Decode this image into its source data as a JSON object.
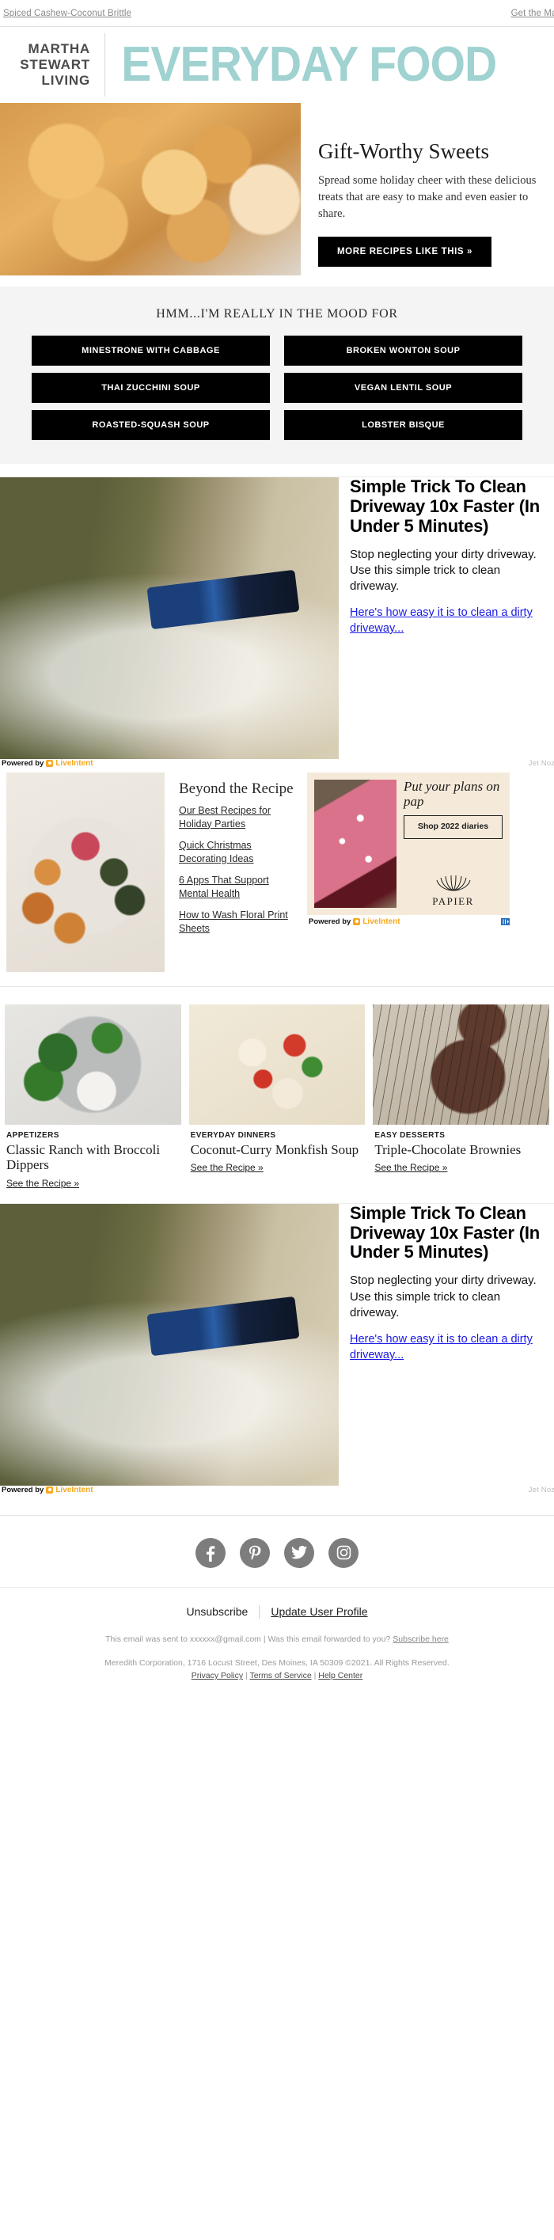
{
  "preheader": {
    "left_link": "Spiced Cashew-Coconut Brittle",
    "right_link": "Get the Magazine"
  },
  "masthead": {
    "brand_line1": "MARTHA",
    "brand_line2": "STEWART",
    "brand_line3": "LIVING",
    "title": "EVERYDAY FOOD",
    "accent_color": "#9fd2d0"
  },
  "hero": {
    "title": "Gift-Worthy Sweets",
    "body": "Spread some holiday cheer with these delicious treats that are easy to make and even easier to share.",
    "cta": "MORE RECIPES LIKE THIS »",
    "image_alt": "cashew brittle"
  },
  "mood": {
    "title": "HMM...I'M REALLY IN THE MOOD FOR",
    "buttons": [
      "MINESTRONE WITH CABBAGE",
      "BROKEN WONTON SOUP",
      "THAI ZUCCHINI SOUP",
      "VEGAN LENTIL SOUP",
      "ROASTED-SQUASH SOUP",
      "LOBSTER BISQUE"
    ]
  },
  "ad": {
    "headline": "Simple Trick To Clean Driveway 10x Faster (In Under 5 Minutes)",
    "body": "Stop neglecting your dirty driveway. Use this simple trick to clean driveway.",
    "link": "Here's how easy it is to clean a dirty driveway...",
    "powered_by": "Powered by",
    "network": "LiveIntent",
    "sponsor": "Jet Nozzle"
  },
  "beyond": {
    "title": "Beyond the Recipe",
    "links": [
      "Our Best Recipes for Holiday Parties",
      "Quick Christmas Decorating Ideas",
      "6 Apps That Support Mental Health",
      "How to Wash Floral Print Sheets"
    ]
  },
  "papier": {
    "headline": "Put your plans on pap",
    "cta": "Shop 2022 diaries",
    "brand": "PAPIER",
    "powered_by": "Powered by",
    "network": "LiveIntent"
  },
  "cards": [
    {
      "kicker": "APPETIZERS",
      "title": "Classic Ranch with Broccoli Dippers",
      "link": "See the Recipe »"
    },
    {
      "kicker": "EVERYDAY DINNERS",
      "title": "Coconut-Curry Monkfish Soup",
      "link": "See the Recipe »"
    },
    {
      "kicker": "EASY DESSERTS",
      "title": "Triple-Chocolate Brownies",
      "link": "See the Recipe »"
    }
  ],
  "social": [
    {
      "name": "facebook",
      "glyph": "f"
    },
    {
      "name": "pinterest",
      "glyph": "p"
    },
    {
      "name": "twitter",
      "glyph": "🐦"
    },
    {
      "name": "instagram",
      "glyph": "▢"
    }
  ],
  "footer": {
    "unsubscribe": "Unsubscribe",
    "update_profile": "Update User Profile",
    "sent_to_prefix": "This email was sent to xxxxxx@gmail.com",
    "separator": "|",
    "forwarded": "Was this email forwarded to you?",
    "subscribe": "Subscribe here",
    "company": "Meredith Corporation, 1716 Locust Street, Des Moines, IA 50309 ©2021. All Rights Reserved.",
    "privacy": "Privacy Policy",
    "terms": "Terms of Service",
    "help": "Help Center"
  }
}
